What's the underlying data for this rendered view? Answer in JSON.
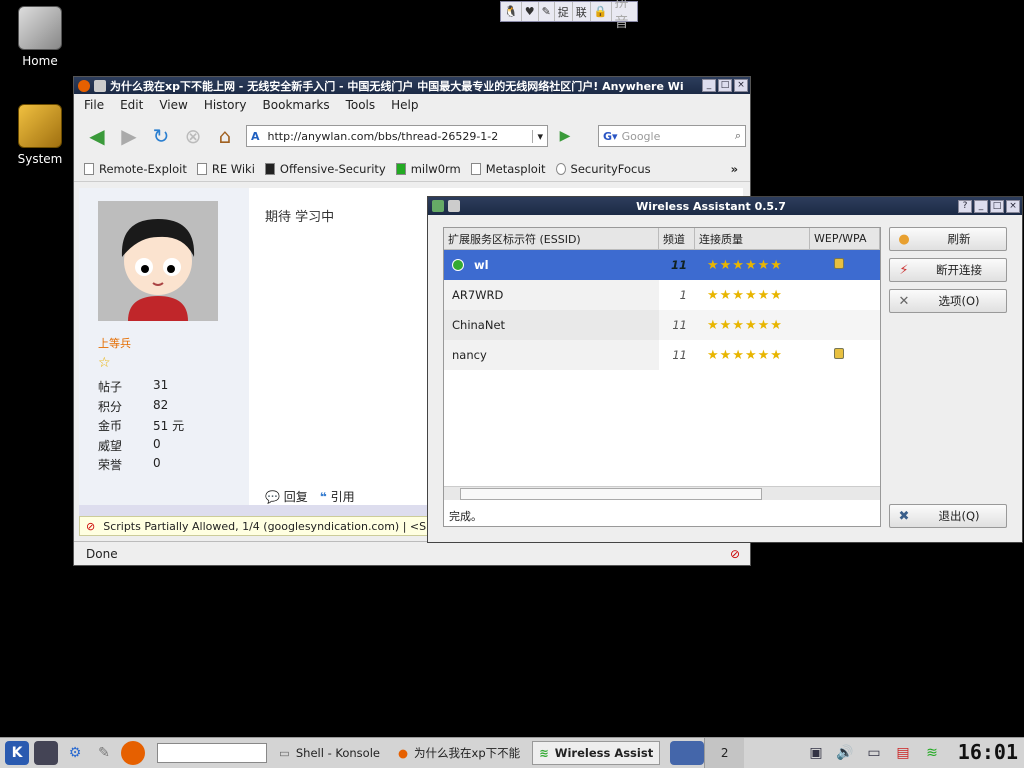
{
  "desktop": {
    "icons": [
      {
        "label": "Home"
      },
      {
        "label": "System"
      }
    ]
  },
  "ime": {
    "items": [
      "🐧",
      "♥",
      "✎",
      "捉",
      "联",
      "🔒"
    ],
    "mode": "拼音"
  },
  "firefox": {
    "title": "为什么我在xp下不能上网 - 无线安全新手入门 - 中国无线门户 中国最大最专业的无线网络社区门户! Anywhere Wi",
    "menu": [
      "File",
      "Edit",
      "View",
      "History",
      "Bookmarks",
      "Tools",
      "Help"
    ],
    "url": "http://anywlan.com/bbs/thread-26529-1-2",
    "search_placeholder": "Google",
    "bookmarks": [
      "Remote-Exploit",
      "RE Wiki",
      "Offensive-Security",
      "milw0rm",
      "Metasploit",
      "SecurityFocus"
    ],
    "bookmark_more": "»",
    "user": {
      "rank": "上等兵",
      "stats": [
        {
          "k": "帖子",
          "v": "31"
        },
        {
          "k": "积分",
          "v": "82"
        },
        {
          "k": "金币",
          "v": "51 元"
        },
        {
          "k": "威望",
          "v": "0"
        },
        {
          "k": "荣誉",
          "v": "0"
        }
      ]
    },
    "post_text": "期待 学习中",
    "reply_label": "回复",
    "quote_label": "引用",
    "notice": "Scripts Partially Allowed, 1/4 (googlesyndication.com) | <S",
    "status": "Done"
  },
  "wireless": {
    "title": "Wireless Assistant 0.5.7",
    "columns": [
      "扩展服务区标示符 (ESSID)",
      "频道",
      "连接质量",
      "WEP/WPA"
    ],
    "networks": [
      {
        "essid": "wl",
        "channel": "11",
        "quality": "★★★★★★",
        "locked": true
      },
      {
        "essid": "AR7WRD",
        "channel": "1",
        "quality": "★★★★★★",
        "locked": false
      },
      {
        "essid": "ChinaNet",
        "channel": "11",
        "quality": "★★★★★★",
        "locked": false
      },
      {
        "essid": "nancy",
        "channel": "11",
        "quality": "★★★★★★",
        "locked": true
      }
    ],
    "status": "完成。",
    "buttons": {
      "refresh": "刷新",
      "disconnect": "断开连接",
      "options": "选项(O)",
      "quit": "退出(Q)"
    }
  },
  "taskbar": {
    "tasks": [
      "Shell - Konsole",
      "为什么我在xp下不能",
      "Wireless Assist"
    ],
    "pager": "2",
    "clock": "16:01"
  }
}
